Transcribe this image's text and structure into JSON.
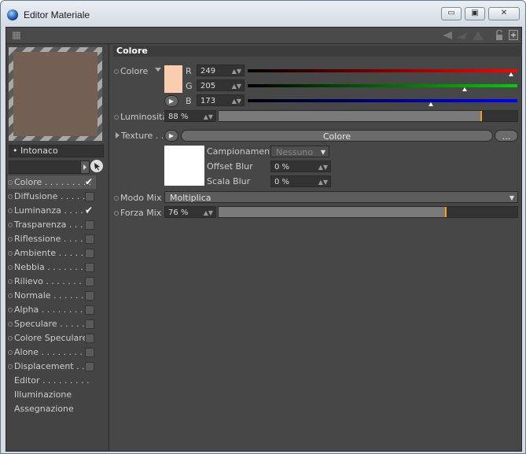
{
  "window": {
    "title": "Editor Materiale",
    "minimize": "▭",
    "maximize": "▣",
    "close": "✕"
  },
  "material": {
    "name": "Intonaco",
    "preview_color": "#735f53"
  },
  "channels": [
    {
      "label": "Colore . . . . . . . . .",
      "checked": true,
      "selected": true
    },
    {
      "label": "Diffusione . . . . . .",
      "checked": false
    },
    {
      "label": "Luminanza . . . . .",
      "checked": true
    },
    {
      "label": "Trasparenza . . . .",
      "checked": false
    },
    {
      "label": "Riflessione . . . . .",
      "checked": false
    },
    {
      "label": "Ambiente . . . . . .",
      "checked": false
    },
    {
      "label": "Nebbia . . . . . . . .",
      "checked": false
    },
    {
      "label": "Rilievo . . . . . . . .",
      "checked": false
    },
    {
      "label": "Normale . . . . . . .",
      "checked": false
    },
    {
      "label": "Alpha . . . . . . . . .",
      "checked": false
    },
    {
      "label": "Speculare . . . . . .",
      "checked": false
    },
    {
      "label": "Colore Speculare",
      "checked": false
    },
    {
      "label": "Alone . . . . . . . . .",
      "checked": false
    },
    {
      "label": "Displacement . . .",
      "checked": false
    }
  ],
  "extra_items": [
    "Editor . . . . . . . . .",
    "Illuminazione",
    "Assegnazione"
  ],
  "section": {
    "title": "Colore"
  },
  "color": {
    "label": "Colore",
    "swatch": "#f9cdad",
    "r_label": "R",
    "r": "249",
    "g_label": "G",
    "g": "205",
    "b_label": "B",
    "b": "173",
    "r_frac": 0.976,
    "g_frac": 0.804,
    "b_frac": 0.678
  },
  "luminosita": {
    "label": "Luminosità",
    "value": "88 %",
    "frac": 0.88
  },
  "texture": {
    "label": "Texture . . .",
    "button": "Colore",
    "more": "...",
    "campionamento_label": "Campionamento",
    "campionamento_value": "Nessuno",
    "offset_label": "Offset Blur",
    "offset_value": "0 %",
    "scala_label": "Scala Blur",
    "scala_value": "0 %"
  },
  "modo_mix": {
    "label": "Modo Mix",
    "value": "Moltiplica"
  },
  "forza_mix": {
    "label": "Forza Mix",
    "value": "76 %",
    "frac": 0.76
  }
}
